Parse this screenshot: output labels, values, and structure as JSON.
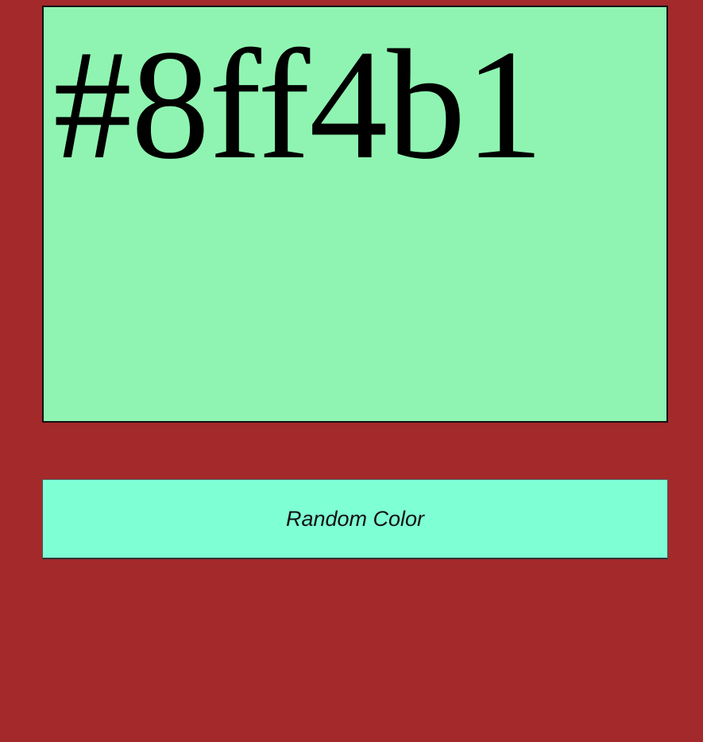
{
  "colors": {
    "page_background": "#a3292b",
    "swatch_background": "#8ff4b1",
    "button_background": "#7fffd4"
  },
  "swatch": {
    "hex_label": "#8ff4b1"
  },
  "button": {
    "label": "Random Color"
  }
}
